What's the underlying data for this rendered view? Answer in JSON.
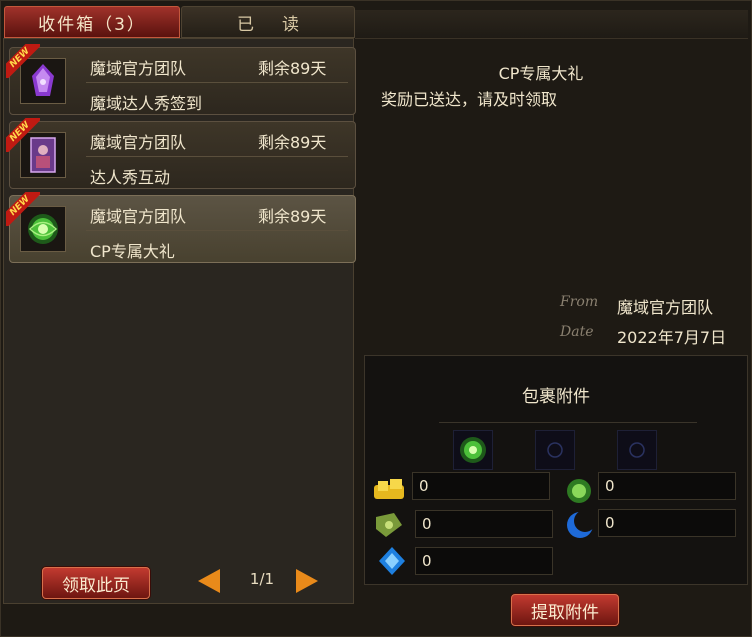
{
  "tabs": {
    "inbox": "收件箱（3）",
    "read": "已读"
  },
  "mails": [
    {
      "badge": "NEW",
      "sender": "魔域官方团队",
      "remain": "剩余89天",
      "subject": "魔域达人秀签到",
      "icon": "purple-crystal-icon",
      "selected": false
    },
    {
      "badge": "NEW",
      "sender": "魔域官方团队",
      "remain": "剩余89天",
      "subject": "达人秀互动",
      "icon": "card-icon",
      "selected": false
    },
    {
      "badge": "NEW",
      "sender": "魔域官方团队",
      "remain": "剩余89天",
      "subject": "CP专属大礼",
      "icon": "green-orb-icon",
      "selected": true
    }
  ],
  "left_footer": {
    "claim_page_button": "领取此页",
    "page_indicator": "1/1"
  },
  "detail": {
    "title": "CP专属大礼",
    "body": "奖励已送达，请及时领取",
    "from_label": "From",
    "from_value": "魔域官方团队",
    "date_label": "Date",
    "date_value": "2022年7月7日"
  },
  "attachments": {
    "title": "包裹附件",
    "slots": [
      "green-orb-icon",
      "empty-slot",
      "empty-slot"
    ],
    "currencies": [
      {
        "icon": "gold-coin-icon",
        "value": "0"
      },
      {
        "icon": "green-gem-icon",
        "value": "0"
      },
      {
        "icon": "tag-icon",
        "value": "0"
      },
      {
        "icon": "blue-moon-icon",
        "value": "0"
      },
      {
        "icon": "blue-crystal-icon",
        "value": "0"
      }
    ],
    "claim_button": "提取附件"
  },
  "colors": {
    "accent_red": "#a0322a",
    "arrow_orange": "#e98a1a",
    "panel": "#2a2620"
  }
}
